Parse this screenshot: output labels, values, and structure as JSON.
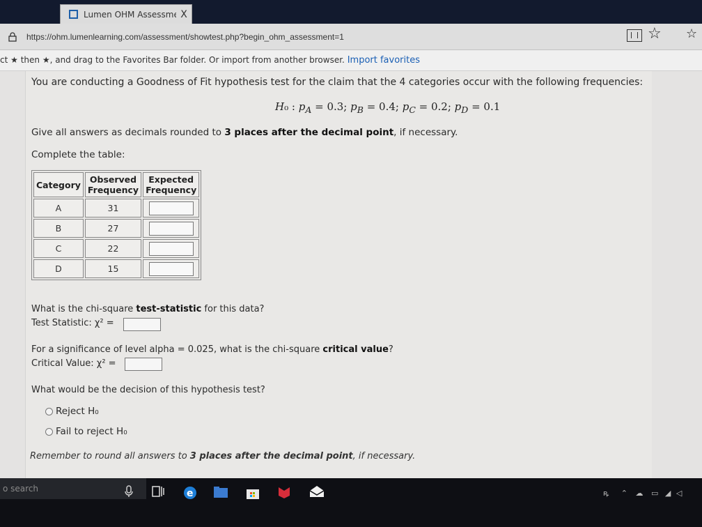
{
  "browser": {
    "tab_title": "Lumen OHM Assessmer",
    "tab_close": "X",
    "url": "https://ohm.lumenlearning.com/assessment/showtest.php?begin_ohm_assessment=1",
    "favorites_notice": "then ★, and drag to the Favorites Bar folder. Or import from another browser.",
    "favorites_prefix": "ct",
    "import_link": "Import favorites"
  },
  "question": {
    "intro": "You are conducting a Goodness of Fit hypothesis test for the claim that the 4 categories occur with the following frequencies:",
    "hypothesis": "H₀ : pₐ = 0.3;  pʙ = 0.4;  pᴄ = 0.2;  pᴅ = 0.1",
    "round_instruction_pre": "Give all answers as decimals rounded to ",
    "round_instruction_bold": "3 places after the decimal point",
    "round_instruction_post": ", if necessary.",
    "complete_table": "Complete the table:",
    "table": {
      "headers": [
        "Category",
        "Observed Frequency",
        "Expected Frequency"
      ],
      "rows": [
        {
          "category": "A",
          "observed": "31"
        },
        {
          "category": "B",
          "observed": "27"
        },
        {
          "category": "C",
          "observed": "22"
        },
        {
          "category": "D",
          "observed": "15"
        }
      ]
    },
    "test_stat_question_pre": "What is the chi-square ",
    "test_stat_question_bold": "test-statistic",
    "test_stat_question_post": " for this data?",
    "test_stat_label": "Test Statistic: χ² =",
    "critical_question_pre": "For a significance of level alpha = 0.025, what is the chi-square ",
    "critical_question_bold": "critical value",
    "critical_question_post": "?",
    "critical_label": "Critical Value: χ² =",
    "decision_question": "What would be the decision of this hypothesis test?",
    "options": [
      "Reject H₀",
      "Fail to reject H₀"
    ],
    "remember_pre": "Remember to round all answers to ",
    "remember_bold": "3 places after the decimal point",
    "remember_post": ", if necessary."
  },
  "taskbar": {
    "search_placeholder": "o search"
  },
  "colors": {
    "page_bg": "#e9e8e6",
    "link": "#1a5fb4",
    "taskbar": "#0e0f14"
  }
}
